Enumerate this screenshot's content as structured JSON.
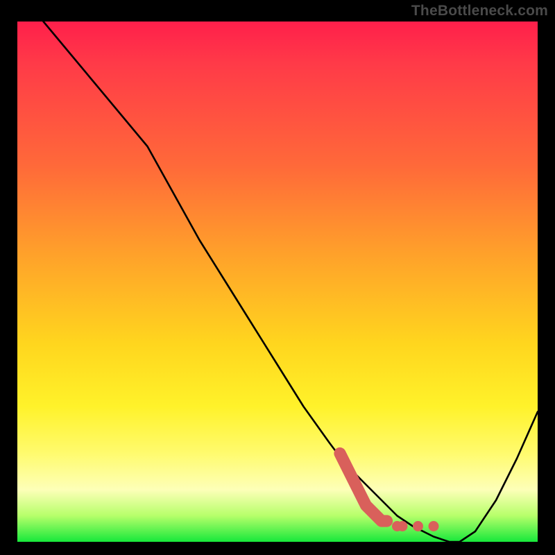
{
  "watermark": "TheBottleneck.com",
  "colors": {
    "background": "#000000",
    "gradient_top": "#ff1f4b",
    "gradient_mid1": "#ffa22a",
    "gradient_mid2": "#fff22a",
    "gradient_bottom": "#17e83b",
    "curve": "#000000",
    "marker": "#d9605b"
  },
  "chart_data": {
    "type": "line",
    "title": "",
    "xlabel": "",
    "ylabel": "",
    "xlim": [
      0,
      100
    ],
    "ylim": [
      0,
      100
    ],
    "grid": false,
    "legend": false,
    "series": [
      {
        "name": "bottleneck-curve",
        "x": [
          5,
          10,
          15,
          20,
          25,
          30,
          35,
          40,
          45,
          50,
          55,
          60,
          63,
          67,
          70,
          73,
          76,
          80,
          83,
          85,
          88,
          92,
          96,
          100
        ],
        "y": [
          100,
          94,
          88,
          82,
          76,
          67,
          58,
          50,
          42,
          34,
          26,
          19,
          15,
          11,
          8,
          5,
          3,
          1,
          0,
          0,
          2,
          8,
          16,
          25
        ]
      }
    ],
    "markers": {
      "name": "highlight-stroke",
      "points": [
        {
          "x": 62,
          "y": 17
        },
        {
          "x": 63,
          "y": 15
        },
        {
          "x": 64,
          "y": 13
        },
        {
          "x": 65,
          "y": 11
        },
        {
          "x": 66,
          "y": 9
        },
        {
          "x": 67,
          "y": 7
        },
        {
          "x": 68,
          "y": 6
        },
        {
          "x": 69,
          "y": 5
        },
        {
          "x": 70,
          "y": 4
        },
        {
          "x": 71,
          "y": 4
        },
        {
          "x": 73,
          "y": 3
        },
        {
          "x": 74,
          "y": 3
        },
        {
          "x": 77,
          "y": 3
        },
        {
          "x": 80,
          "y": 3
        }
      ]
    }
  }
}
